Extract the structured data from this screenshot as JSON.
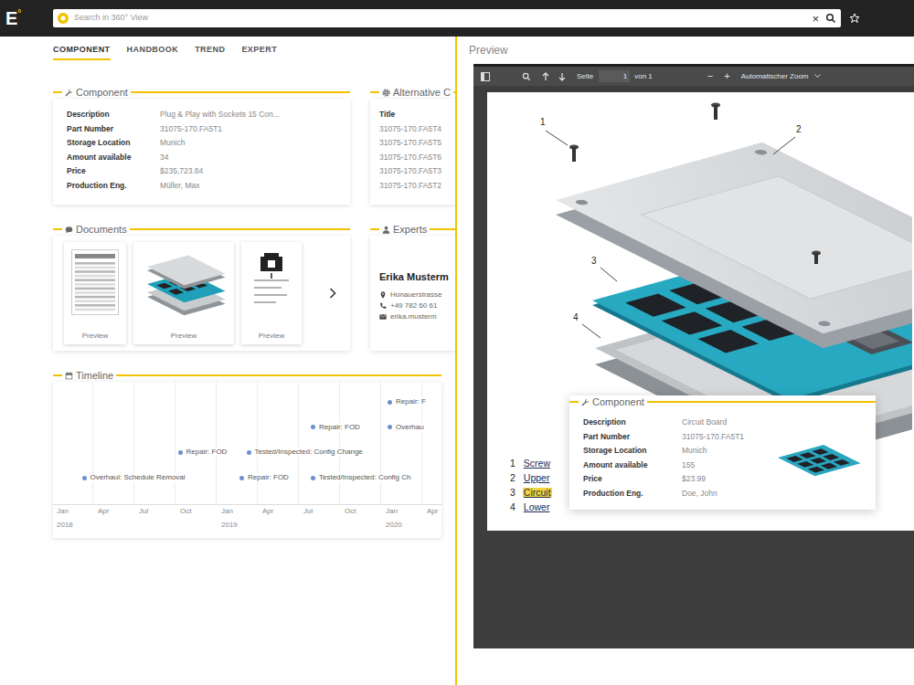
{
  "header": {
    "logo": "E",
    "logo_mark": "°"
  },
  "search": {
    "placeholder": "Search in 360° View",
    "clear": "×"
  },
  "tabs": [
    {
      "label": "COMPONENT",
      "selected": true
    },
    {
      "label": "HANDBOOK",
      "selected": false
    },
    {
      "label": "TREND",
      "selected": false
    },
    {
      "label": "EXPERT",
      "selected": false
    }
  ],
  "component": {
    "title": "Component",
    "fields": [
      {
        "label": "Description",
        "value": "Plug & Play with Sockets 15 Con..."
      },
      {
        "label": "Part Number",
        "value": "31075-170.FA5T1"
      },
      {
        "label": "Storage Location",
        "value": "Munich"
      },
      {
        "label": "Amount available",
        "value": "34"
      },
      {
        "label": "Price",
        "value": "$235,723.84"
      },
      {
        "label": "Production Eng.",
        "value": "Müller, Max"
      }
    ]
  },
  "alternatives": {
    "title": "Alternative C",
    "header": "Title",
    "rows": [
      "31075-170.FA5T4",
      "31075-170.FA5T5",
      "31075-170.FA5T6",
      "31075-170.FA5T3",
      "31075-170.FA5T2"
    ]
  },
  "documents": {
    "title": "Documents",
    "items": [
      {
        "label": "Preview",
        "kind": "sheet"
      },
      {
        "label": "Preview",
        "kind": "exploded"
      },
      {
        "label": "Preview",
        "kind": "drawing"
      }
    ]
  },
  "experts": {
    "title": "Experts",
    "name": "Erika Musterm",
    "address": "Honauerstrasse",
    "phone": "+49 782 60 61",
    "email": "erika.musterm"
  },
  "timeline": {
    "title": "Timeline",
    "months": [
      "Jan",
      "Apr",
      "Jul",
      "Oct",
      "Jan",
      "Apr",
      "Jul",
      "Oct",
      "Jan",
      "Apr"
    ],
    "years": [
      "2018",
      "2019",
      "2020"
    ],
    "events": [
      {
        "label": "Overhaul: Schedule Removal",
        "month": 2,
        "row": 3
      },
      {
        "label": "Repair: FOD",
        "month": 9,
        "row": 2
      },
      {
        "label": "Tested/Inspected: Config Change",
        "month": 14,
        "row": 2
      },
      {
        "label": "Repair: FOD",
        "month": 13.5,
        "row": 3
      },
      {
        "label": "Tested/Inspected: Config Ch",
        "month": 18.7,
        "row": 3
      },
      {
        "label": "Repair: FOD",
        "month": 18.7,
        "row": 1
      },
      {
        "label": "Overhau",
        "month": 24.3,
        "row": 1
      },
      {
        "label": "Repair: F",
        "month": 24.3,
        "row": 0
      }
    ]
  },
  "preview": {
    "title": "Preview",
    "toolbar": {
      "page_label": "Seite",
      "page": "1",
      "page_count": "von 1",
      "zoom_out": "−",
      "zoom_in": "+",
      "zoom": "Automatischer Zoom"
    },
    "callouts": [
      "1",
      "2",
      "3",
      "4"
    ],
    "parts": [
      {
        "number": "1",
        "label": "Screw",
        "selected": false
      },
      {
        "number": "2",
        "label": "Upper",
        "selected": false
      },
      {
        "number": "3",
        "label": "Circuit",
        "selected": true
      },
      {
        "number": "4",
        "label": "Lower",
        "selected": false
      }
    ],
    "popup": {
      "title": "Component",
      "fields": [
        {
          "label": "Description",
          "value": "Circuit Board"
        },
        {
          "label": "Part Number",
          "value": "31075-170.FA5T1"
        },
        {
          "label": "Storage Location",
          "value": "Munich"
        },
        {
          "label": "Amount available",
          "value": "155"
        },
        {
          "label": "Price",
          "value": "$23.99"
        },
        {
          "label": "Production Eng.",
          "value": "Doe, John"
        }
      ]
    }
  }
}
